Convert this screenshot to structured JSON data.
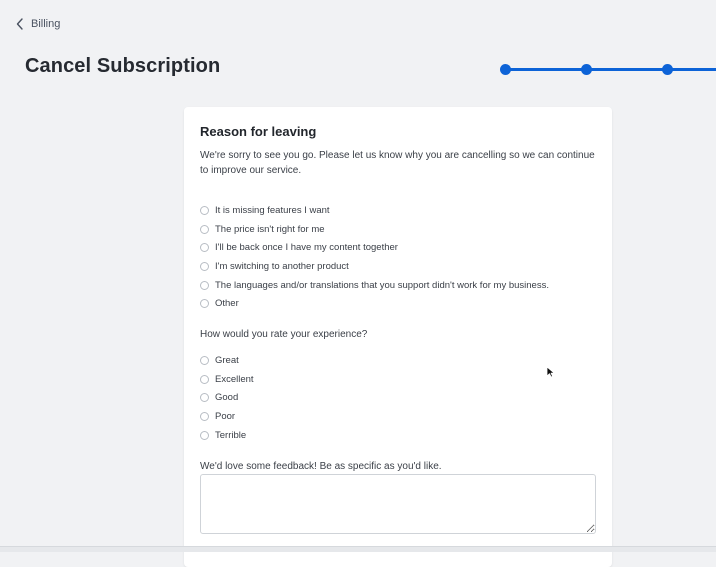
{
  "breadcrumb": {
    "back_label": "Billing"
  },
  "header": {
    "title": "Cancel Subscription"
  },
  "stepper": {
    "steps_visible": 3,
    "accent_color": "#0d63d7"
  },
  "card": {
    "title": "Reason for leaving",
    "description": "We're sorry to see you go. Please let us know why you are cancelling so we can continue to improve our service.",
    "reasons": [
      "It is missing features I want",
      "The price isn't right for me",
      "I'll be back once I have my content together",
      "I'm switching to another product",
      "The languages and/or translations that you support didn't work for my business.",
      "Other"
    ],
    "rating_question": "How would you rate your experience?",
    "ratings": [
      "Great",
      "Excellent",
      "Good",
      "Poor",
      "Terrible"
    ],
    "feedback_label": "We'd love some feedback! Be as specific as you'd like.",
    "feedback_value": "",
    "feedback_placeholder": ""
  }
}
